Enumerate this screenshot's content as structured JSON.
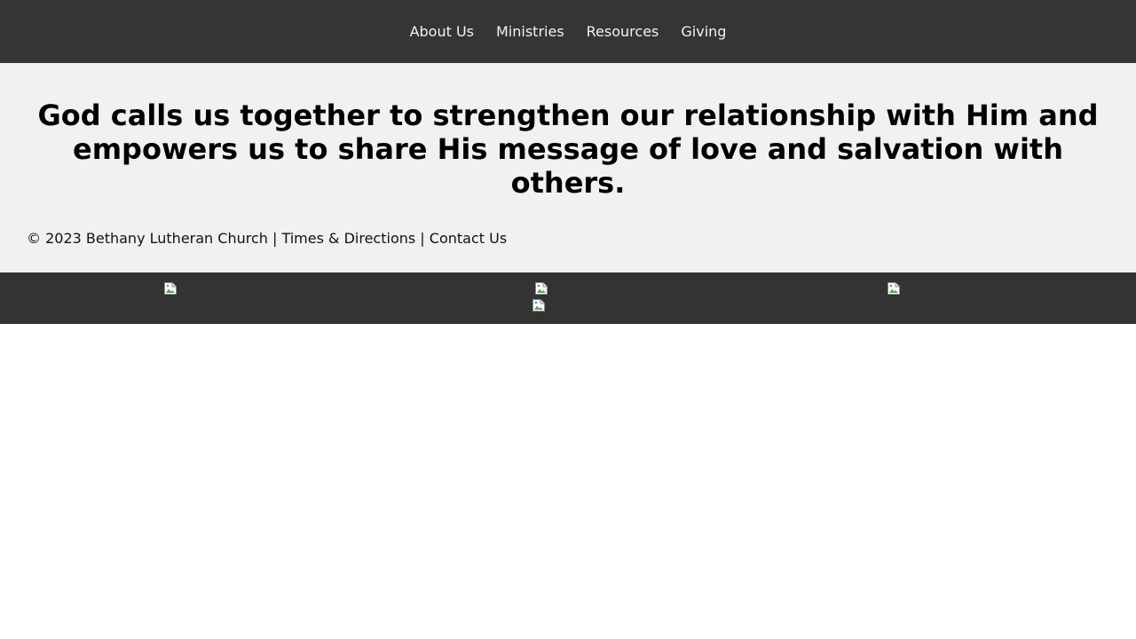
{
  "nav": {
    "items": [
      {
        "label": "About Us"
      },
      {
        "label": "Ministries"
      },
      {
        "label": "Resources"
      },
      {
        "label": "Giving"
      }
    ]
  },
  "hero": {
    "heading": "God calls us together to strengthen our relationship with Him and empowers us to share His message of love and salvation with others."
  },
  "footer": {
    "copyright": "© 2023 Bethany Lutheran Church",
    "separator": " | ",
    "times_link": "Times & Directions",
    "contact_link": "Contact Us"
  },
  "image_bar": {
    "images": [
      {
        "icon": "broken-image-icon"
      },
      {
        "icon": "broken-image-icon"
      },
      {
        "icon": "broken-image-icon"
      },
      {
        "icon": "broken-image-icon"
      }
    ]
  },
  "colors": {
    "nav_bg": "#353535",
    "hero_bg": "#f1f1f1",
    "image_bar_bg": "#333333"
  }
}
